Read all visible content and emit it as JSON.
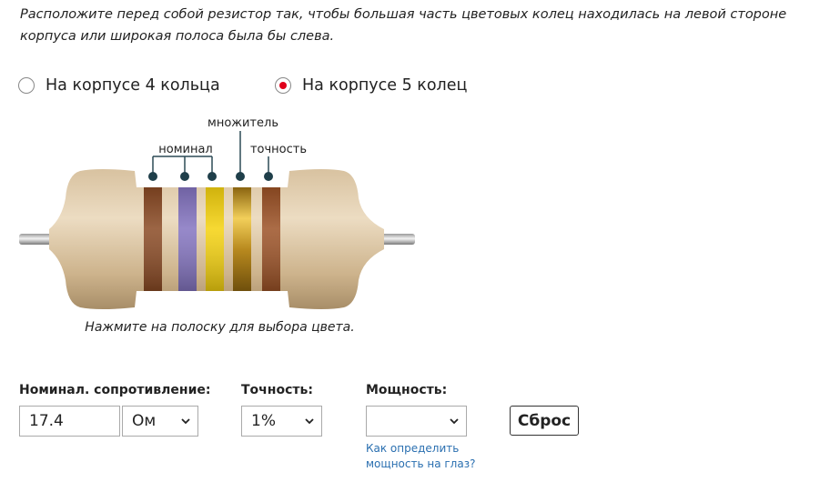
{
  "instruction": "Расположите перед собой резистор так, чтобы большая часть цветовых колец находилась на левой стороне корпуса или широкая полоса была бы слева.",
  "band_mode": {
    "options": [
      {
        "label": "На корпусе 4 кольца",
        "selected": false
      },
      {
        "label": "На корпусе 5 колец",
        "selected": true
      }
    ]
  },
  "resistor": {
    "labels": {
      "nominal": "номинал",
      "multiplier": "множитель",
      "tolerance": "точность"
    },
    "bands": [
      {
        "role": "digit-1",
        "color": "#8a4a24"
      },
      {
        "role": "digit-2",
        "color": "#8474c0"
      },
      {
        "role": "digit-3",
        "color": "#f5d20f"
      },
      {
        "role": "multiplier",
        "color": "gold"
      },
      {
        "role": "tolerance",
        "color": "#9c5226"
      }
    ],
    "caption": "Нажмите на полоску для выбора цвета."
  },
  "form": {
    "nominal_label": "Номинал. сопротивление:",
    "nominal_value": "17.4",
    "unit_value": "Ом",
    "tolerance_label": "Точность:",
    "tolerance_value": "1%",
    "power_label": "Мощность:",
    "power_value": "",
    "reset_label": "Сброс",
    "power_help_link": "Как определить мощность на глаз?"
  },
  "colors": {
    "accent_red": "#e0001b",
    "link_blue": "#2a6fb0"
  }
}
